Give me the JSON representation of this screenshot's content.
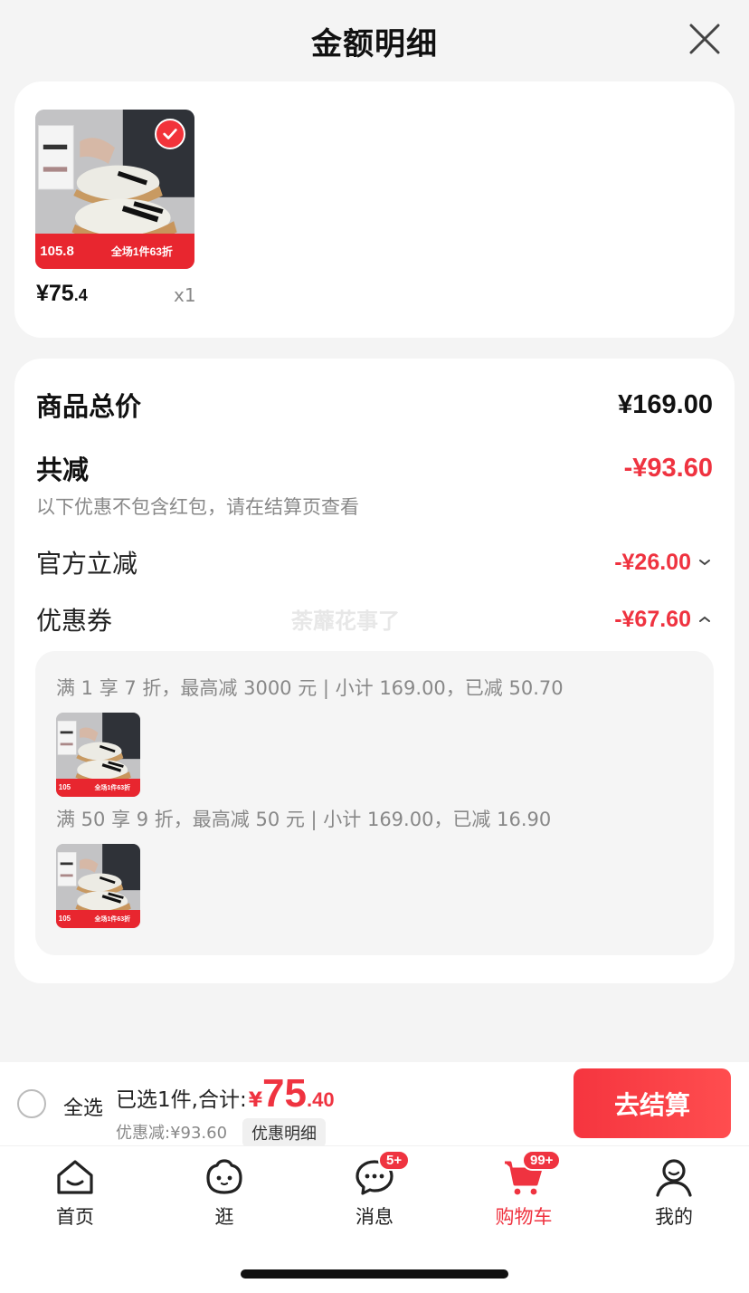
{
  "header": {
    "title": "金额明细"
  },
  "product": {
    "price_int": "¥75",
    "price_dec": ".4",
    "quantity": "x1",
    "thumb_promo_price": "105.8",
    "thumb_promo_text": "全场1件63折"
  },
  "summary": {
    "total_label": "商品总价",
    "total_value": "¥169.00",
    "reduce_label": "共减",
    "reduce_value": "-¥93.60",
    "note": "以下优惠不包含红包，请在结算页查看",
    "official_label": "官方立减",
    "official_value": "-¥26.00",
    "coupon_label": "优惠券",
    "coupon_value": "-¥67.60",
    "watermark": "荼蘼花事了"
  },
  "coupons": [
    {
      "line": "满 1 享 7 折，最高减 3000 元 | 小计 169.00，已减 50.70"
    },
    {
      "line": "满 50 享 9 折，最高减 50 元 | 小计 169.00，已减 16.90"
    }
  ],
  "small_thumb": {
    "promo_price": "105",
    "promo_text": "全场1件63折"
  },
  "checkout": {
    "select_all_label": "全选",
    "selected_text": "已选1件,合计:",
    "currency": "¥",
    "amount_int": "75",
    "amount_dec": ".40",
    "discount_text": "优惠减:¥93.60",
    "detail_tag": "优惠明细",
    "button_label": "去结算"
  },
  "tabbar": {
    "items": [
      {
        "label": "首页",
        "icon": "home-icon"
      },
      {
        "label": "逛",
        "icon": "face-icon"
      },
      {
        "label": "消息",
        "icon": "message-icon",
        "badge": "5+"
      },
      {
        "label": "购物车",
        "icon": "cart-icon",
        "badge": "99+",
        "active": true
      },
      {
        "label": "我的",
        "icon": "profile-icon"
      }
    ]
  },
  "colors": {
    "accent_red": "#ef3340",
    "background": "#f4f4f4"
  }
}
